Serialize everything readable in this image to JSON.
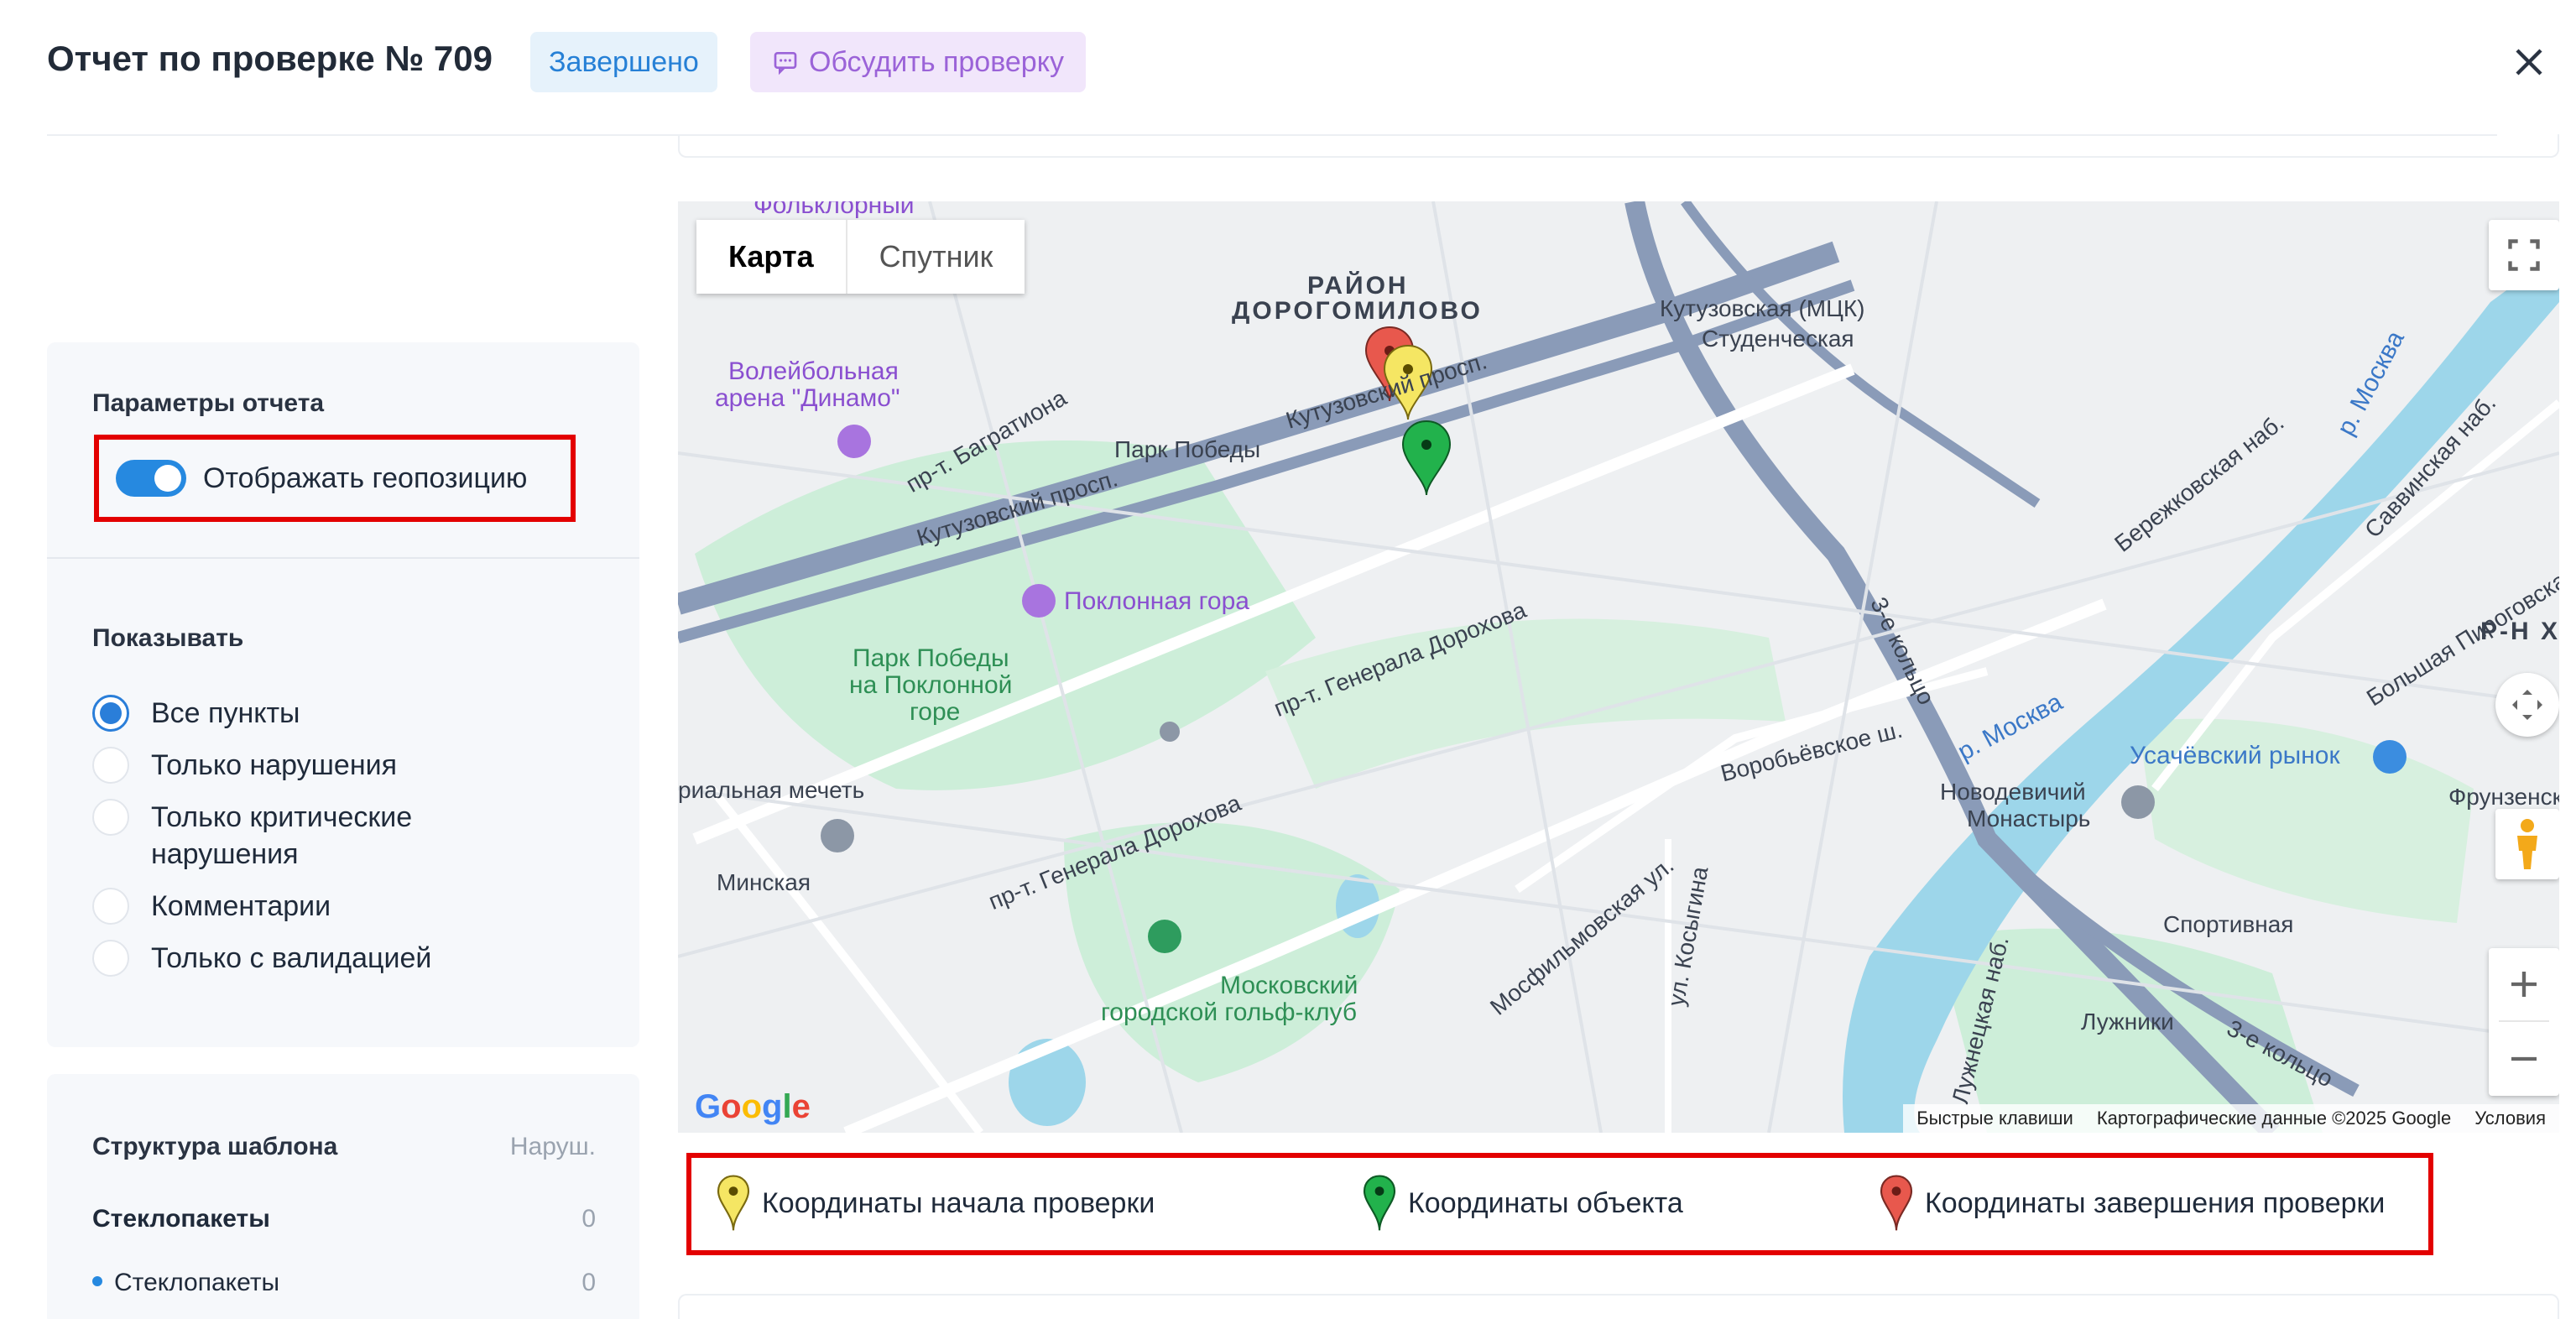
{
  "header": {
    "title": "Отчет по проверке № 709",
    "status": "Завершено",
    "discuss_label": "Обсудить проверку"
  },
  "params": {
    "title": "Параметры отчета",
    "geo_toggle_label": "Отображать геопозицию",
    "geo_toggle_on": true
  },
  "show": {
    "title": "Показывать",
    "options": [
      {
        "label": "Все пункты",
        "checked": true
      },
      {
        "label": "Только нарушения",
        "checked": false
      },
      {
        "label": "Только критические нарушения",
        "checked": false
      },
      {
        "label": "Комментарии",
        "checked": false
      },
      {
        "label": "Только с валидацией",
        "checked": false
      }
    ]
  },
  "structure": {
    "title": "Структура шаблона",
    "col_label": "Наруш.",
    "group": {
      "name": "Стеклопакеты",
      "count": "0"
    },
    "item": {
      "name": "Стеклопакеты",
      "count": "0"
    }
  },
  "map": {
    "type_map": "Карта",
    "type_satellite": "Спутник",
    "labels": {
      "district1": "РАЙОН",
      "district2": "ДОРОГОМИЛОВО",
      "folk": "Фольклорный",
      "arena1": "Волейбольная",
      "arena2": "арена \"Динамо\"",
      "park_pobedy": "Парк Победы",
      "kutuz_mck": "Кутузовская (МЦК)",
      "studencheskaya": "Студенческая",
      "poklonnaya": "Поклонная гора",
      "park1": "Парк Победы",
      "park2": "на Поклонной",
      "park3": "горе",
      "mosque": "риальная мечеть",
      "minskaya": "Минская",
      "golf1": "Московский",
      "golf2": "городской гольф-клуб",
      "novodev1": "Новодевичий",
      "novodev2": "Монастырь",
      "usach": "Усачёвский рынок",
      "sportivnaya": "Спортивная",
      "luzhniki": "Лужники",
      "frunz": "Фрунзенск",
      "rnh": "Р-Н ХА",
      "r_moskva": "р. Москва",
      "kutuz_prosp": "Кутузовский просп.",
      "bagrationa": "пр-т. Багратиона",
      "dorokhova": "пр-т. Генерала Дорохова",
      "vorobiev": "Воробьёвское ш.",
      "third_ring": "3-е кольцо",
      "mosfilm": "Мосфильмовская ул.",
      "kosygina": "ул. Косыгина",
      "berezh": "Бережковская наб.",
      "luzhnets": "Лужнецкая наб.",
      "savvin": "Саввинская наб.",
      "pirog": "Большая Пироговская ул."
    },
    "footer": {
      "shortcuts": "Быстрые клавиши",
      "data": "Картографические данные ©2025 Google",
      "terms": "Условия"
    },
    "google": "Google"
  },
  "legend": {
    "start": "Координаты начала проверки",
    "object": "Координаты объекта",
    "end": "Координаты завершения проверки"
  },
  "colors": {
    "accent": "#2689e0",
    "pin_start": "#f5e663",
    "pin_object": "#22b24c",
    "pin_end": "#e8584d",
    "highlight": "#e30000"
  }
}
